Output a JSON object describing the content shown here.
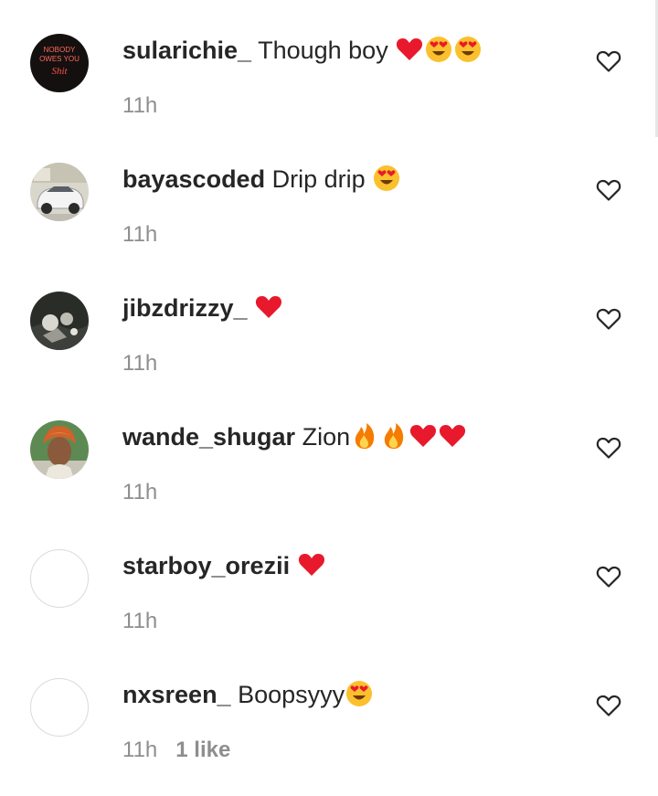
{
  "comments": [
    {
      "username": "sularichie_",
      "text": "Though boy ",
      "emojis": [
        "red-heart-emoji",
        "heart-eyes-emoji",
        "heart-eyes-emoji"
      ],
      "time": "11h",
      "likes": "",
      "avatar": "neon-sign-avatar",
      "avatar_text": [
        "NOBODY",
        "OWES YOU",
        "Shit"
      ]
    },
    {
      "username": "bayascoded",
      "text": "Drip drip ",
      "emojis": [
        "heart-eyes-emoji"
      ],
      "time": "11h",
      "likes": "",
      "avatar": "car-avatar"
    },
    {
      "username": "jibzdrizzy_",
      "text": " ",
      "emojis": [
        "red-heart-emoji"
      ],
      "time": "11h",
      "likes": "",
      "avatar": "dark-photo-avatar"
    },
    {
      "username": "wande_shugar",
      "text": "Zion",
      "emojis": [
        "fire-emoji",
        "fire-emoji",
        "red-heart-emoji",
        "red-heart-emoji"
      ],
      "time": "11h",
      "likes": "",
      "avatar": "woman-headwrap-avatar"
    },
    {
      "username": "starboy_orezii",
      "text": " ",
      "emojis": [
        "red-heart-emoji"
      ],
      "time": "11h",
      "likes": "",
      "avatar": "empty-avatar"
    },
    {
      "username": "nxsreen_",
      "text": "Boopsyyy",
      "emojis": [
        "heart-eyes-emoji"
      ],
      "time": "11h",
      "likes": "1 like",
      "avatar": "empty-avatar"
    }
  ],
  "colors": {
    "text": "#262626",
    "secondary": "#8e8e8e",
    "heart_red": "#e8192c",
    "emoji_yellow": "#fbc02d",
    "fire_orange": "#f57c00"
  },
  "icons": {
    "like": "heart-outline-icon"
  }
}
